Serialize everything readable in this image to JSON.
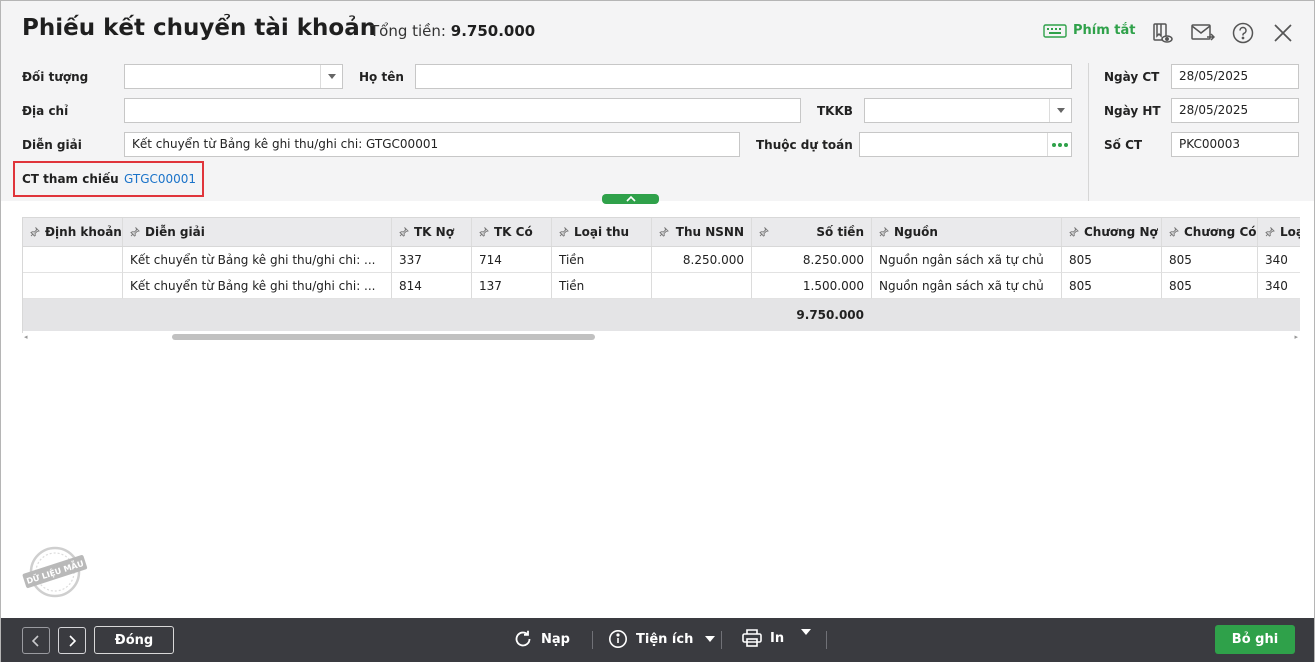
{
  "header": {
    "title": "Phiếu kết chuyển tài khoản",
    "total_label": "Tổng tiền:",
    "total_value": "9.750.000",
    "shortcut_label": "Phím tắt"
  },
  "form": {
    "doi_tuong": {
      "label": "Đối tượng",
      "value": ""
    },
    "ho_ten": {
      "label": "Họ tên",
      "value": ""
    },
    "dia_chi": {
      "label": "Địa chỉ",
      "value": ""
    },
    "tkkb": {
      "label": "TKKB",
      "value": ""
    },
    "dien_giai": {
      "label": "Diễn giải",
      "value": "Kết chuyển từ Bảng kê ghi thu/ghi chi: GTGC00001"
    },
    "thuoc_du_toan": {
      "label": "Thuộc dự toán",
      "value": ""
    },
    "ct_tham_chieu": {
      "label": "CT tham chiếu",
      "value": "GTGC00001"
    },
    "ngay_ct": {
      "label": "Ngày CT",
      "value": "28/05/2025"
    },
    "ngay_ht": {
      "label": "Ngày HT",
      "value": "28/05/2025"
    },
    "so_ct": {
      "label": "Số CT",
      "value": "PKC00003"
    }
  },
  "grid": {
    "columns": [
      "Định khoản",
      "Diễn giải",
      "TK Nợ",
      "TK Có",
      "Loại thu",
      "Thu NSNN",
      "Số tiền",
      "Nguồn",
      "Chương Nợ",
      "Chương Có",
      "Loạ"
    ],
    "rows": [
      [
        "",
        "Kết chuyển từ Bảng kê ghi thu/ghi chi: ...",
        "337",
        "714",
        "Tiền",
        "8.250.000",
        "8.250.000",
        "Nguồn ngân sách xã tự chủ",
        "805",
        "805",
        "340"
      ],
      [
        "",
        "Kết chuyển từ Bảng kê ghi thu/ghi chi: ...",
        "814",
        "137",
        "Tiền",
        "",
        "1.500.000",
        "Nguồn ngân sách xã tự chủ",
        "805",
        "805",
        "340"
      ]
    ],
    "total": "9.750.000"
  },
  "watermark_text": "DỮ LIỆU MẪU",
  "footer": {
    "close_label": "Đóng",
    "reload_label": "Nạp",
    "utility_label": "Tiện ích",
    "print_label": "In",
    "save_label": "Bỏ ghi"
  },
  "colors": {
    "accent_green": "#2fa14a",
    "link_blue": "#1a73c9",
    "highlight_red": "#e0353b",
    "footer_bg": "#3a3b40"
  }
}
